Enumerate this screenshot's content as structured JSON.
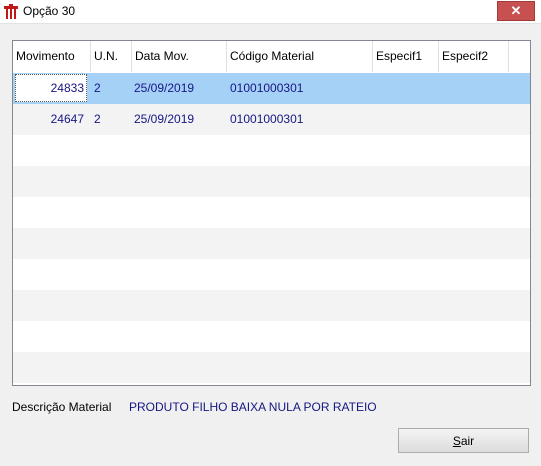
{
  "window": {
    "title": "Opção 30",
    "close_glyph": "✕"
  },
  "grid": {
    "columns": [
      "Movimento",
      "U.N.",
      "Data Mov.",
      "Código Material",
      "Especif1",
      "Especif2"
    ],
    "rows": [
      {
        "movimento": "24833",
        "un": "2",
        "data_mov": "25/09/2019",
        "codigo_material": "01001000301",
        "especif1": "",
        "especif2": ""
      },
      {
        "movimento": "24647",
        "un": "2",
        "data_mov": "25/09/2019",
        "codigo_material": "01001000301",
        "especif1": "",
        "especif2": ""
      }
    ],
    "selected_row": 0
  },
  "footer": {
    "descricao_label": "Descrição Material",
    "descricao_value": "PRODUTO FILHO BAIXA NULA POR RATEIO",
    "sair_first": "S",
    "sair_rest": "air"
  },
  "colors": {
    "accent_text": "#161683",
    "selection": "#a6d1f7",
    "close_button": "#c75050"
  }
}
